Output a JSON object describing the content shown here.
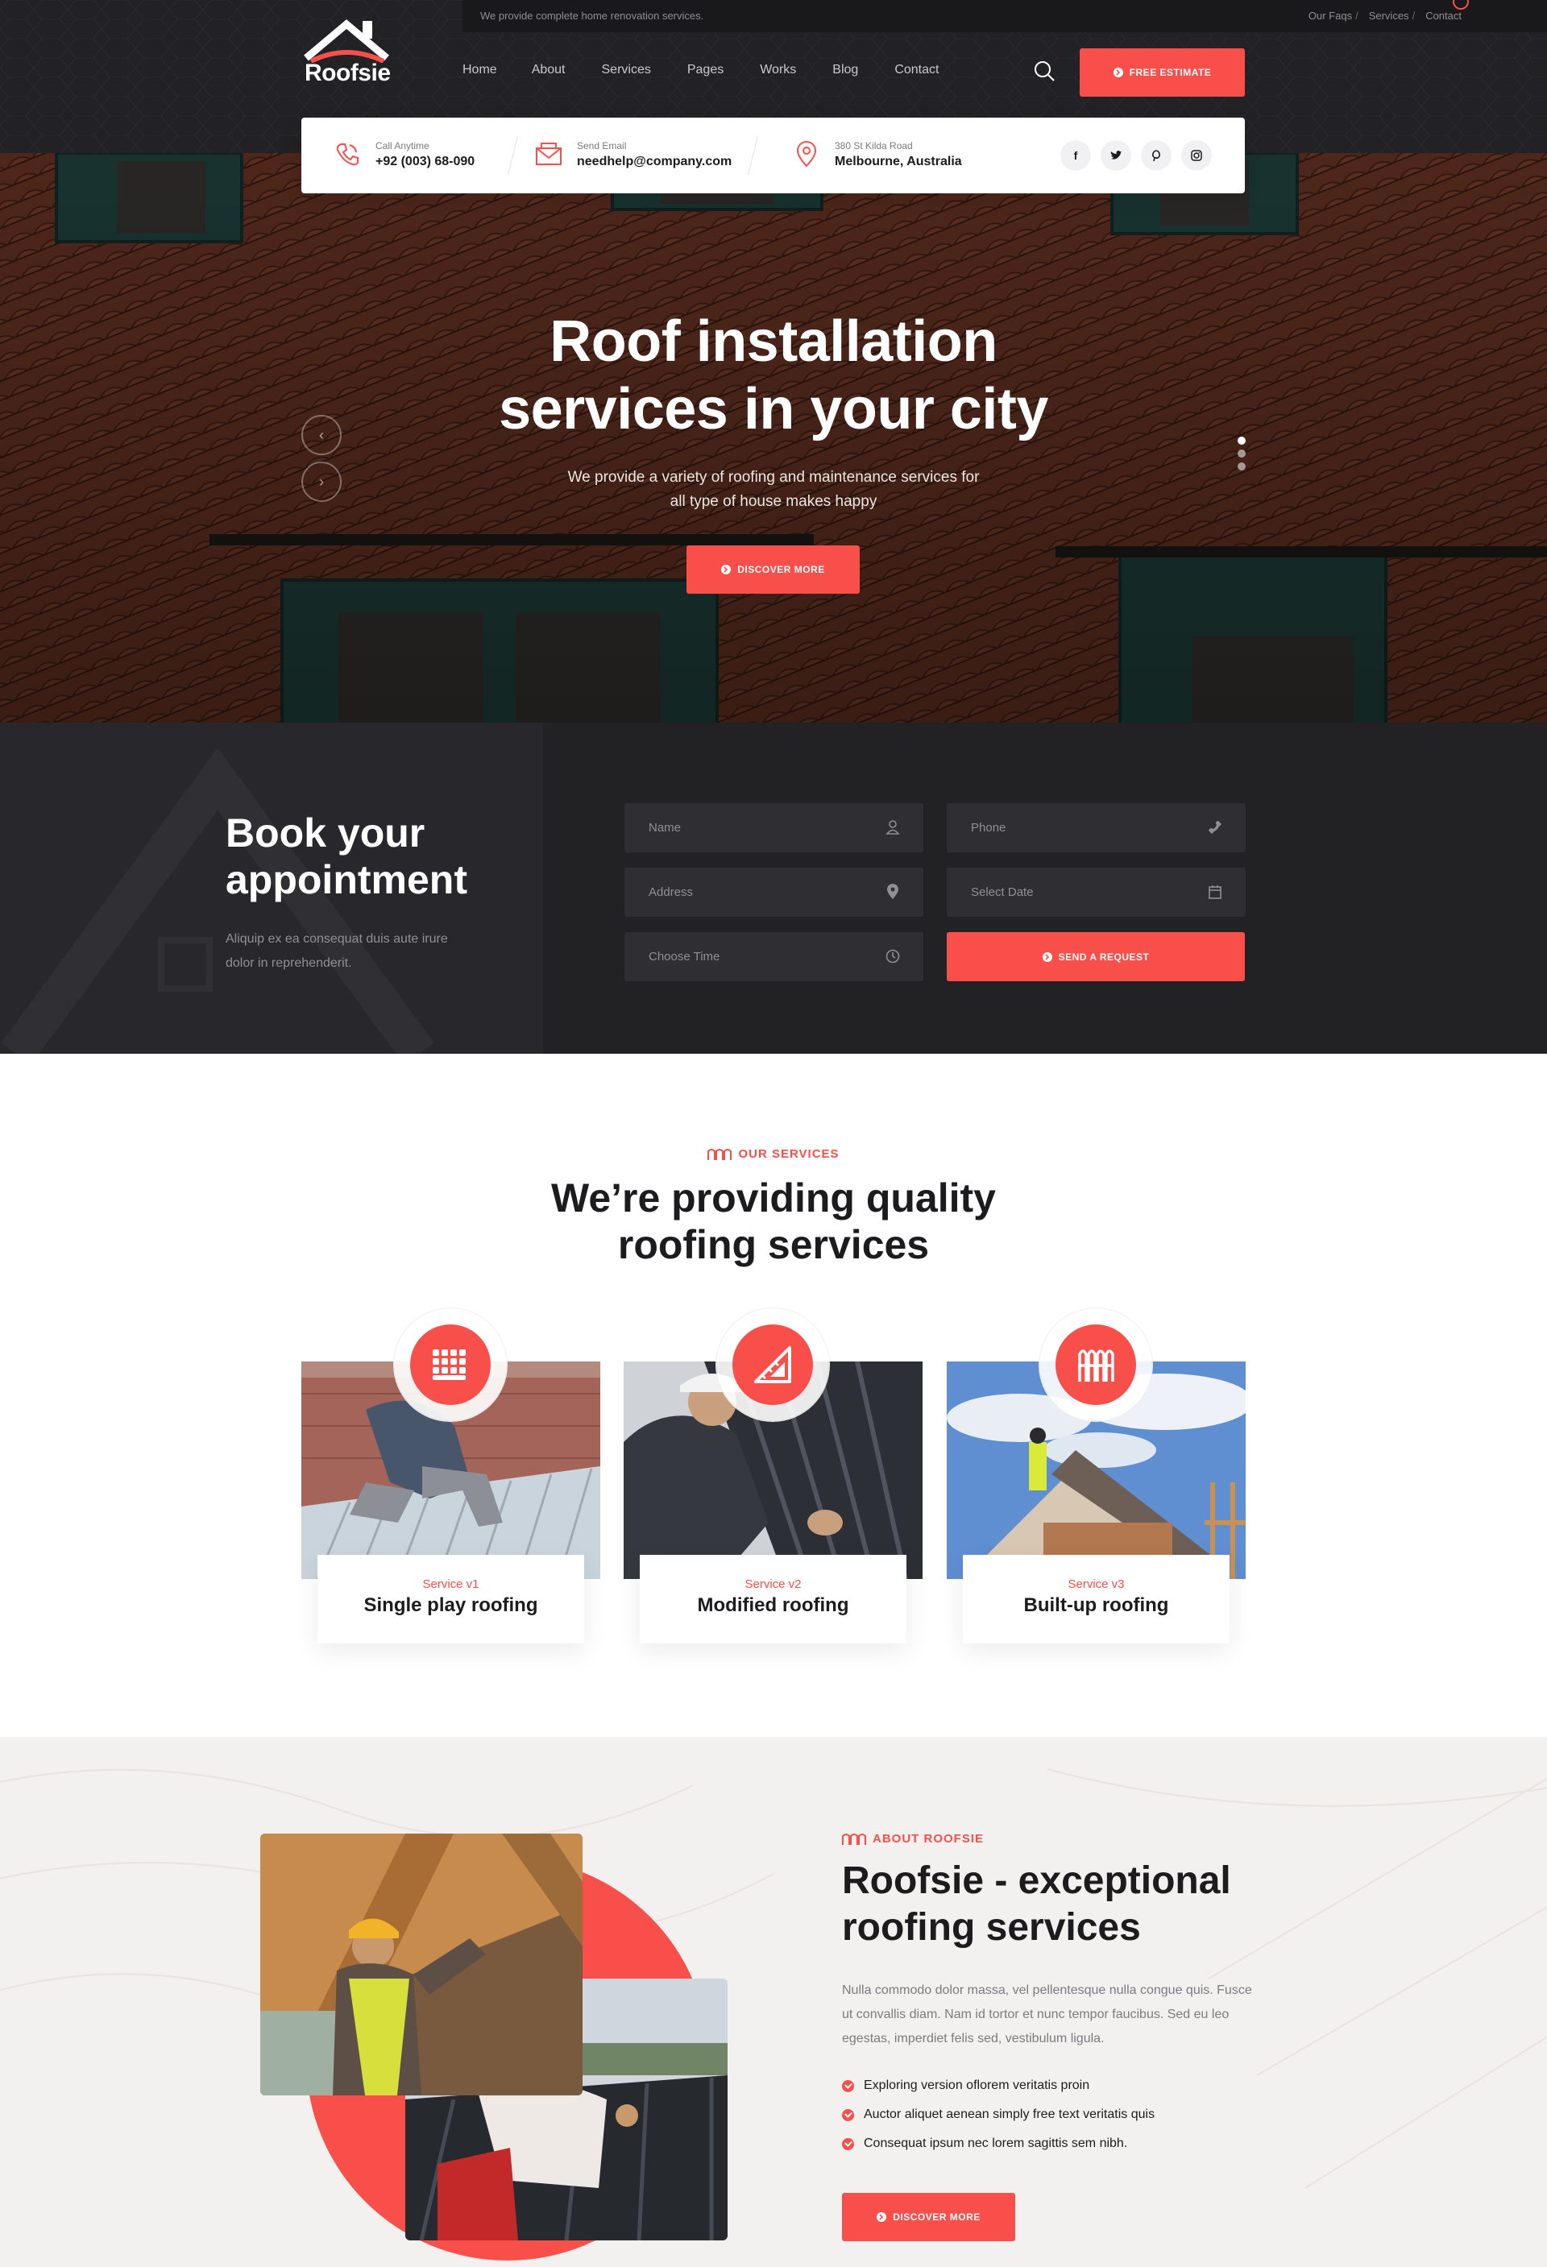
{
  "brand": {
    "name": "Roofsie",
    "accent": "#f94f4a",
    "dark": "#222225"
  },
  "topbar": {
    "note": "We provide complete home renovation services.",
    "links": [
      "Our Faqs",
      "Services",
      "Contact"
    ]
  },
  "nav": {
    "items": [
      "Home",
      "About",
      "Services",
      "Pages",
      "Works",
      "Blog",
      "Contact"
    ]
  },
  "header": {
    "estimate_label": "FREE ESTIMATE",
    "search_icon": "search-icon"
  },
  "contact": {
    "phone_label": "Call Anytime",
    "phone": "+92 (003) 68-090",
    "email_label": "Send Email",
    "email": "needhelp@company.com",
    "address_label": "380 St Kilda Road",
    "address": "Melbourne, Australia",
    "socials": [
      "facebook-icon",
      "twitter-icon",
      "pinterest-icon",
      "instagram-icon"
    ]
  },
  "hero": {
    "title_line1": "Roof installation",
    "title_line2": "services in your city",
    "sub_line1": "We provide a variety of roofing and maintenance services for",
    "sub_line2": "all type of house makes happy",
    "button_label": "DISCOVER MORE",
    "slides_total": 3,
    "active_slide": 1
  },
  "appointment": {
    "title_line1": "Book your",
    "title_line2": "appointment",
    "text_line1": "Aliquip ex ea consequat duis aute irure",
    "text_line2": "dolor in reprehenderit.",
    "fields": {
      "name": "Name",
      "phone": "Phone",
      "address": "Address",
      "date": "Select Date",
      "time": "Choose Time"
    },
    "button_label": "SEND A REQUEST"
  },
  "services": {
    "tagline": "OUR SERVICES",
    "title_line1": "We’re providing quality",
    "title_line2": "roofing services",
    "cards": [
      {
        "sub": "Service v1",
        "name": "Single play roofing",
        "icon": "roof-tiles-icon"
      },
      {
        "sub": "Service v2",
        "name": "Modified roofing",
        "icon": "ruler-triangle-icon"
      },
      {
        "sub": "Service v3",
        "name": "Built-up roofing",
        "icon": "roof-sheets-icon"
      }
    ]
  },
  "about": {
    "tagline": "ABOUT ROOFSIE",
    "title_line1": "Roofsie - exceptional",
    "title_line2": "roofing services",
    "text": "Nulla commodo dolor massa, vel pellentesque nulla congue quis. Fusce ut convallis diam. Nam id tortor et nunc tempor faucibus. Sed eu leo egestas, imperdiet felis sed, vestibulum ligula.",
    "checks": [
      "Exploring version oflorem veritatis proin",
      "Auctor aliquet aenean simply free text veritatis quis",
      "Consequat ipsum nec lorem sagittis sem nibh."
    ],
    "button_label": "DISCOVER MORE"
  }
}
